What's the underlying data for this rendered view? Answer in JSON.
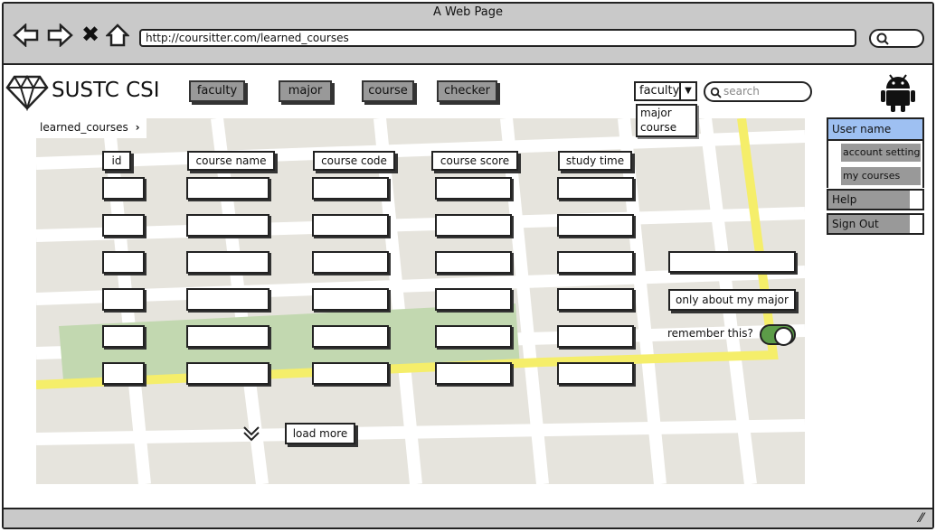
{
  "window": {
    "title": "A Web Page",
    "url": "http://coursitter.com/learned_courses"
  },
  "brand": {
    "name": "SUSTC CSI"
  },
  "nav": {
    "buttons": [
      "faculty",
      "major",
      "course",
      "checker"
    ]
  },
  "filter": {
    "selected": "faculty",
    "options": [
      "major",
      "course"
    ]
  },
  "search": {
    "placeholder": "search"
  },
  "breadcrumb": {
    "label": "learned_courses"
  },
  "table": {
    "columns": [
      "id",
      "course name",
      "course code",
      "course score",
      "study time"
    ],
    "row_count": 6
  },
  "side_panel": {
    "only_major_button": "only about my major",
    "remember_label": "remember this?",
    "remember_on": true
  },
  "load_more": {
    "label": "load more"
  },
  "user_menu": {
    "user": "User name",
    "items": [
      "account setting",
      "my courses",
      "Help",
      "Sign Out"
    ]
  },
  "colors": {
    "highlight": "#9ec0f2",
    "toggle": "#5c9c48",
    "map_road": "#f5ee6a",
    "map_park": "#c2d8b0"
  }
}
